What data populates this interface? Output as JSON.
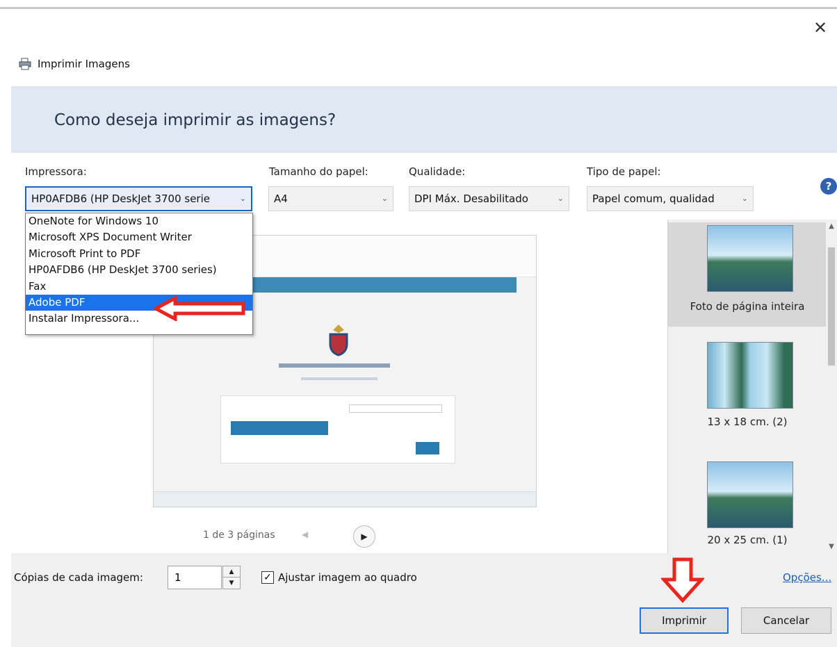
{
  "window": {
    "title": "Imprimir Imagens",
    "close_glyph": "✕"
  },
  "header": {
    "question": "Como deseja imprimir as imagens?"
  },
  "fields": {
    "printer": {
      "label": "Impressora:",
      "value": "HP0AFDB6 (HP DeskJet 3700 serie"
    },
    "paper_size": {
      "label": "Tamanho do papel:",
      "value": "A4"
    },
    "quality": {
      "label": "Qualidade:",
      "value": "DPI Máx. Desabilitado"
    },
    "paper_type": {
      "label": "Tipo de papel:",
      "value": "Papel comum, qualidad"
    }
  },
  "help_glyph": "?",
  "printer_options": [
    "OneNote for Windows 10",
    "Microsoft XPS Document Writer",
    "Microsoft Print to PDF",
    "HP0AFDB6 (HP DeskJet 3700 series)",
    "Fax",
    "Adobe PDF",
    "Instalar Impressora..."
  ],
  "highlighted_option": "Adobe PDF",
  "preview": {
    "page_text": "1 de 3 páginas",
    "prev_glyph": "◀",
    "next_glyph": "▶"
  },
  "layouts": [
    {
      "caption": "Foto de página inteira",
      "selected": true
    },
    {
      "caption": "13 x 18 cm. (2)",
      "selected": false
    },
    {
      "caption": "20 x 25 cm. (1)",
      "selected": false
    }
  ],
  "footer": {
    "copies_label": "Cópias de cada imagem:",
    "copies_value": "1",
    "fit_label": "Ajustar imagem ao quadro",
    "fit_checked": true,
    "options_link": "Opções...",
    "print_button": "Imprimir",
    "cancel_button": "Cancelar"
  },
  "colors": {
    "annotation_arrow": "#e8251f",
    "accent": "#1a73e8",
    "banner": "#dfe8f3"
  },
  "icons": [
    "printer-icon",
    "close-icon",
    "help-icon",
    "chevron-down-icon",
    "play-icon"
  ]
}
